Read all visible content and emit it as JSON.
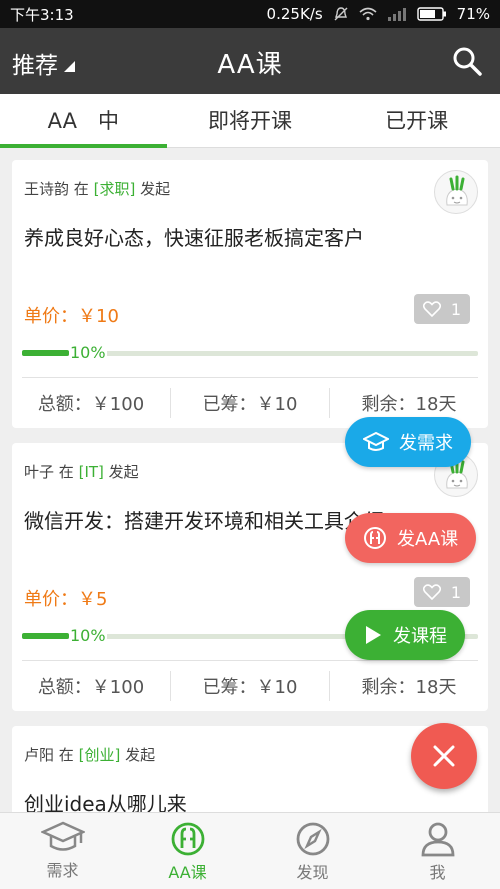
{
  "status": {
    "time": "下午3:13",
    "speed": "0.25K/s",
    "battery": "71%"
  },
  "appbar": {
    "filter_label": "推荐",
    "title": "AA课",
    "icon": "search-icon"
  },
  "tabs": [
    {
      "label": "AA　中",
      "active": true
    },
    {
      "label": "即将开课",
      "active": false
    },
    {
      "label": "已开课",
      "active": false
    }
  ],
  "cards": [
    {
      "author": "王诗韵",
      "in": "在",
      "category": "[求职]",
      "action": "发起",
      "title": "养成良好心态，快速征服老板搞定客户",
      "price": "单价：￥10",
      "likes": "1",
      "progress": 0.1,
      "progress_label": "10%",
      "total": "总额：￥100",
      "raised": "已筹：￥10",
      "remaining": "剩余：18天"
    },
    {
      "author": "叶子",
      "in": "在",
      "category": "[IT]",
      "action": "发起",
      "title": "微信开发：搭建开发环境和相关工具介绍",
      "price": "单价：￥5",
      "likes": "1",
      "progress": 0.1,
      "progress_label": "10%",
      "total": "总额：￥100",
      "raised": "已筹：￥10",
      "remaining": "剩余：18天"
    },
    {
      "author": "卢阳",
      "in": "在",
      "category": "[创业]",
      "action": "发起",
      "title": "创业idea从哪儿来"
    }
  ],
  "fab": {
    "need_label": "发需求",
    "aa_label": "发AA课",
    "course_label": "发课程",
    "colors": {
      "need": "#1aa9e8",
      "aa": "#f2655f",
      "course": "#3cb034",
      "main": "#f05a52"
    }
  },
  "bottom_nav": [
    {
      "label": "需求",
      "icon": "graduation-cap-icon",
      "active": false
    },
    {
      "label": "AA课",
      "icon": "aa-logo-icon",
      "active": true
    },
    {
      "label": "发现",
      "icon": "compass-icon",
      "active": false
    },
    {
      "label": "我",
      "icon": "person-icon",
      "active": false
    }
  ]
}
